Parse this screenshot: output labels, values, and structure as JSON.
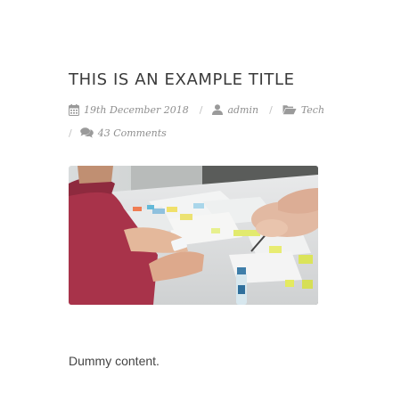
{
  "post": {
    "title": "THIS IS AN EXAMPLE TITLE",
    "date": "19th December 2018",
    "author": "admin",
    "category": "Tech",
    "comments": "43 Comments",
    "separator": "/",
    "content": "Dummy content."
  },
  "icons": {
    "date": "calendar-icon",
    "author": "user-icon",
    "category": "folder-open-icon",
    "comments": "comments-icon"
  },
  "colors": {
    "title": "#3a3a3a",
    "meta": "#8f8f8f",
    "separator": "#c2c2c2",
    "body_text": "#444444"
  }
}
